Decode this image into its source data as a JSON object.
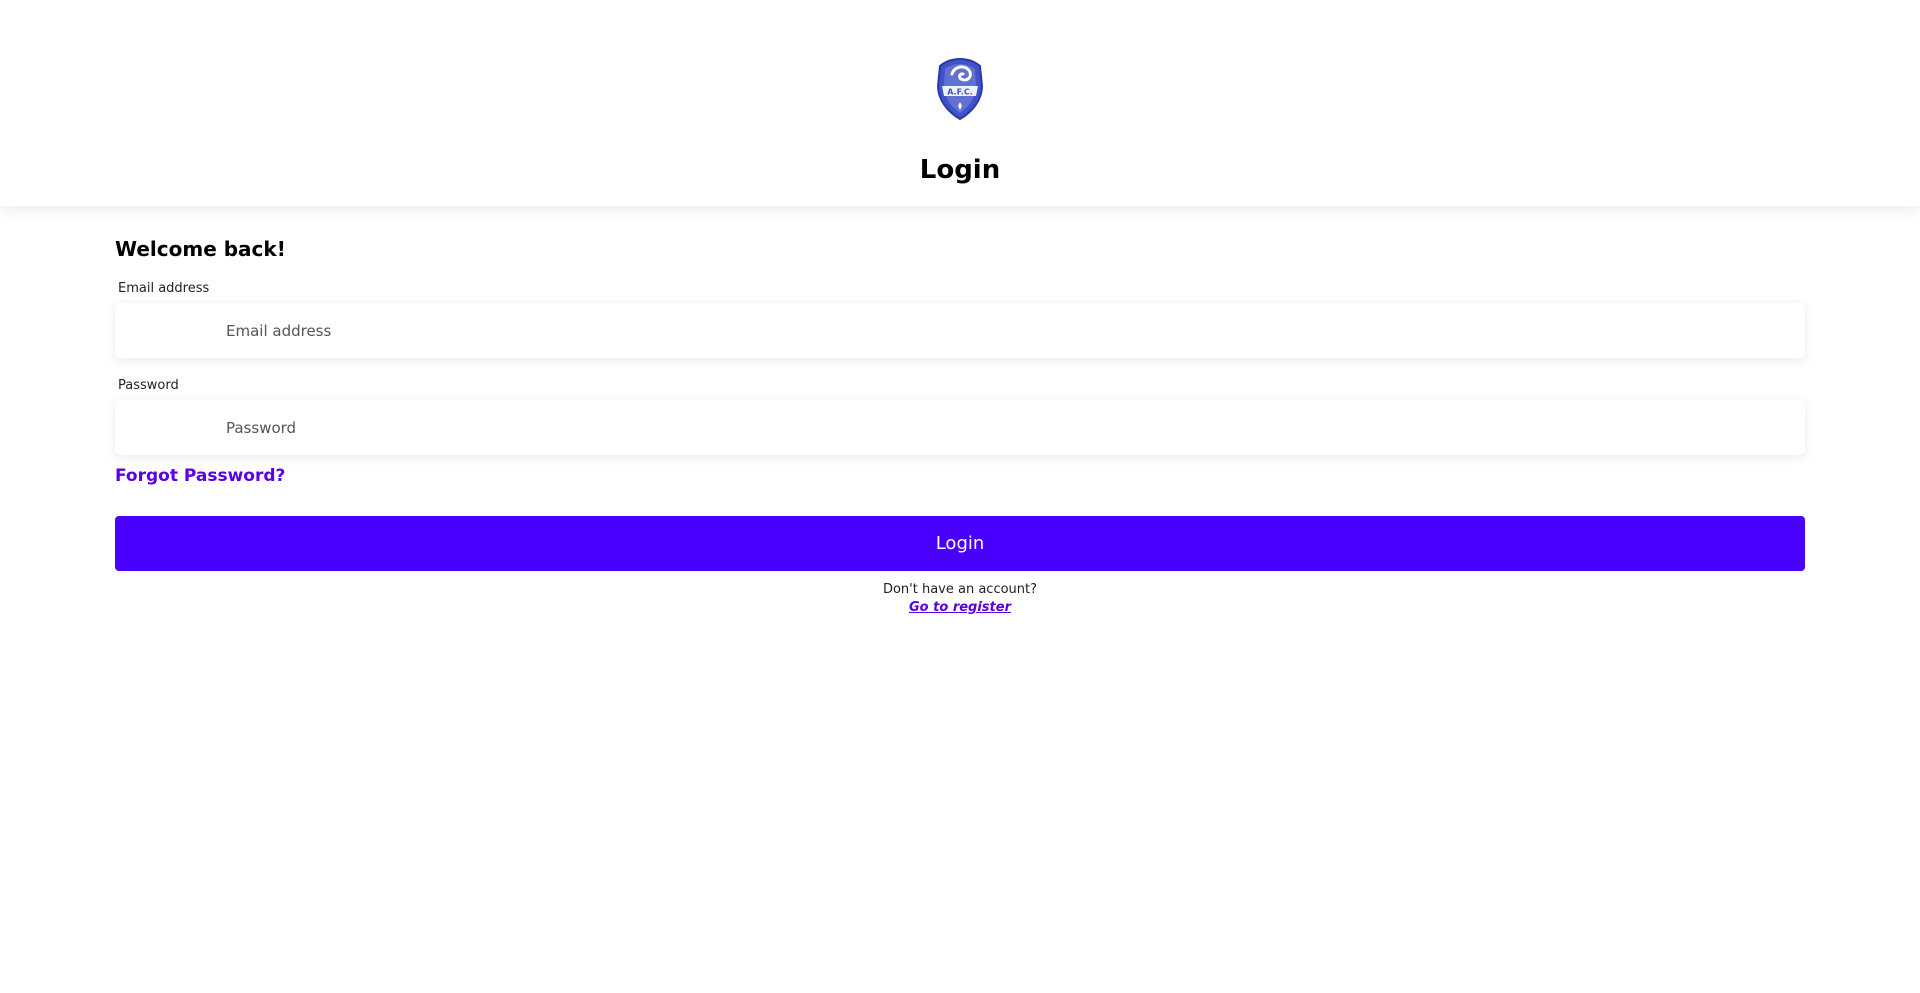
{
  "header": {
    "logo_name": "afc-crest-logo",
    "logo_text": "A.F.C.",
    "title": "Login"
  },
  "form": {
    "welcome": "Welcome back!",
    "email": {
      "label": "Email address",
      "placeholder": "Email address",
      "value": ""
    },
    "password": {
      "label": "Password",
      "placeholder": "Password",
      "value": ""
    },
    "forgot_password": "Forgot Password?",
    "submit_label": "Login",
    "no_account_text": "Don't have an account?",
    "register_link": "Go to register"
  },
  "colors": {
    "accent": "#4a00ff",
    "link": "#5a00e6",
    "logo_blue": "#3f52c8"
  }
}
